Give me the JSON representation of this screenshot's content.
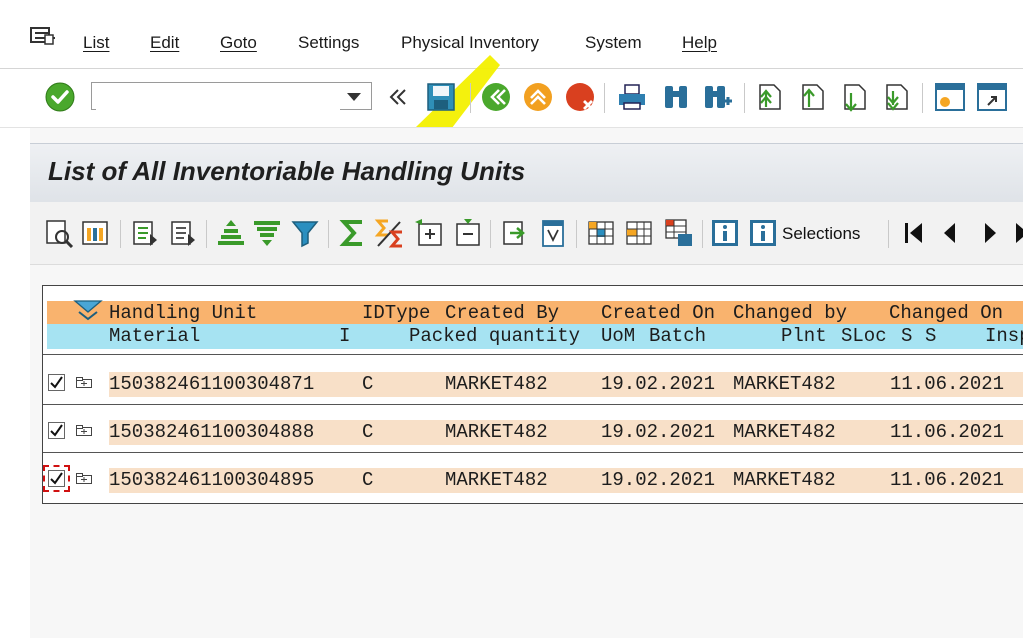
{
  "menu": {
    "items": [
      "List",
      "Edit",
      "Goto",
      "Settings",
      "Physical Inventory",
      "System",
      "Help"
    ]
  },
  "toolbar": {
    "command_field_value": "",
    "icons": [
      "enter-icon",
      "back-icon",
      "save-icon",
      "back-green-icon",
      "exit-icon",
      "cancel-icon",
      "print-icon",
      "find-icon",
      "find-next-icon",
      "first-page-icon",
      "previous-page-icon",
      "next-page-icon",
      "last-page-icon",
      "new-session-icon",
      "create-shortcut-icon"
    ]
  },
  "page": {
    "title": "List of All Inventoriable Handling Units"
  },
  "app_toolbar": {
    "selections_label": "Selections"
  },
  "grid": {
    "header1": {
      "handling_unit": "Handling Unit",
      "idtype": "IDType",
      "created_by": "Created By",
      "created_on": "Created On",
      "changed_by": "Changed by",
      "changed_on": "Changed On"
    },
    "header2": {
      "material": "Material",
      "i": "I",
      "packed_quantity": "Packed quantity",
      "uom": "UoM",
      "batch": "Batch",
      "plnt": "Plnt",
      "sloc": "SLoc",
      "s1": "S",
      "s2": "S",
      "insp": "Insp"
    },
    "rows": [
      {
        "hu": "150382461100304871",
        "idtype": "C",
        "created_by": "MARKET482",
        "created_on": "19.02.2021",
        "changed_by": "MARKET482",
        "changed_on": "11.06.2021",
        "checked": true
      },
      {
        "hu": "150382461100304888",
        "idtype": "C",
        "created_by": "MARKET482",
        "created_on": "19.02.2021",
        "changed_by": "MARKET482",
        "changed_on": "11.06.2021",
        "checked": true
      },
      {
        "hu": "150382461100304895",
        "idtype": "C",
        "created_by": "MARKET482",
        "created_on": "19.02.2021",
        "changed_by": "MARKET482",
        "changed_on": "11.06.2021",
        "checked": true
      }
    ]
  },
  "colors": {
    "header1_bg": "#f9b36e",
    "header2_bg": "#a6e3f2",
    "row_bg": "#f8e0c8",
    "highlighter": "#f3f000"
  }
}
